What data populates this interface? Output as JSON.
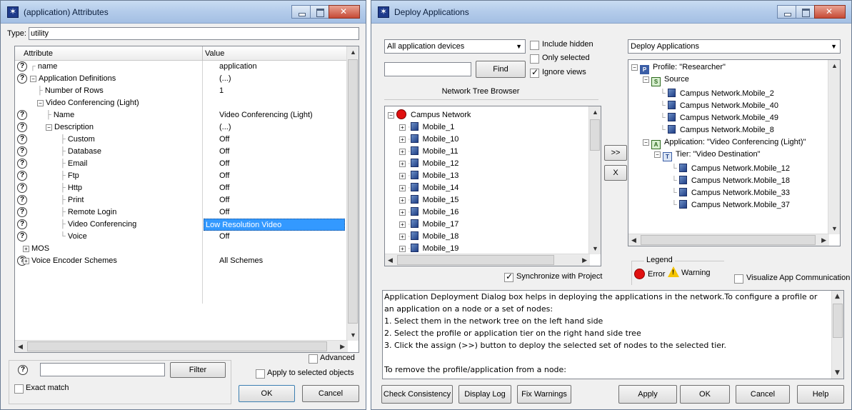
{
  "attributes_window": {
    "title": "(application) Attributes",
    "type_label": "Type:",
    "type_value": "utility",
    "col_attribute": "Attribute",
    "col_value": "Value",
    "rows": [
      {
        "attr": "name",
        "value": "application"
      },
      {
        "attr": "Application Definitions",
        "value": "(...)"
      },
      {
        "attr": "Number of Rows",
        "value": "1"
      },
      {
        "attr": "Video Conferencing (Light)",
        "value": ""
      },
      {
        "attr": "Name",
        "value": "Video Conferencing (Light)"
      },
      {
        "attr": "Description",
        "value": "(...)"
      },
      {
        "attr": "Custom",
        "value": "Off"
      },
      {
        "attr": "Database",
        "value": "Off"
      },
      {
        "attr": "Email",
        "value": "Off"
      },
      {
        "attr": "Ftp",
        "value": "Off"
      },
      {
        "attr": "Http",
        "value": "Off"
      },
      {
        "attr": "Print",
        "value": "Off"
      },
      {
        "attr": "Remote Login",
        "value": "Off"
      },
      {
        "attr": "Video Conferencing",
        "value": "Low Resolution Video"
      },
      {
        "attr": "Voice",
        "value": "Off"
      },
      {
        "attr": "MOS",
        "value": ""
      },
      {
        "attr": "Voice Encoder Schemes",
        "value": "All Schemes"
      }
    ],
    "advanced_label": "Advanced",
    "filter_button": "Filter",
    "apply_selected_label": "Apply to selected objects",
    "exact_match_label": "Exact match",
    "ok_button": "OK",
    "cancel_button": "Cancel",
    "filter_value": ""
  },
  "deploy_window": {
    "title": "Deploy Applications",
    "device_filter": "All application devices",
    "include_hidden": "Include hidden",
    "only_selected": "Only selected",
    "ignore_views": "Ignore views",
    "find_button": "Find",
    "find_value": "",
    "tree_browser_label": "Network Tree Browser",
    "tree_root": "Campus Network",
    "tree_nodes": [
      "Mobile_1",
      "Mobile_10",
      "Mobile_11",
      "Mobile_12",
      "Mobile_13",
      "Mobile_14",
      "Mobile_15",
      "Mobile_16",
      "Mobile_17",
      "Mobile_18",
      "Mobile_19"
    ],
    "assign_button": ">>",
    "remove_button": "X",
    "sync_label": "Synchronize with Project",
    "right_dropdown": "Deploy Applications",
    "profile_label": "Profile: \"Researcher\"",
    "source_label": "Source",
    "source_nodes": [
      "Campus Network.Mobile_2",
      "Campus Network.Mobile_40",
      "Campus Network.Mobile_49",
      "Campus Network.Mobile_8"
    ],
    "application_label": "Application: \"Video Conferencing (Light)\"",
    "tier_label": "Tier: \"Video Destination\"",
    "tier_nodes": [
      "Campus Network.Mobile_12",
      "Campus Network.Mobile_18",
      "Campus Network.Mobile_33",
      "Campus Network.Mobile_37"
    ],
    "legend_title": "Legend",
    "legend_error": "Error",
    "legend_warning": "Warning",
    "visualize_label": "Visualize App Communication",
    "help_lines": [
      "Application Deployment Dialog box helps in deploying the applications in the network.To configure a profile or",
      "an application on a node or a set of nodes:",
      "1. Select them in the network tree on the left hand side",
      "2. Select the profile or application tier on the right hand side tree",
      "3. Click the assign (>>) button to deploy the selected set of nodes to the selected tier.",
      "",
      "To remove the profile/application from a node:"
    ],
    "buttons": {
      "check": "Check Consistency",
      "log": "Display Log",
      "fix": "Fix Warnings",
      "apply": "Apply",
      "ok": "OK",
      "cancel": "Cancel",
      "help": "Help"
    }
  },
  "colors": {
    "selection": "#3399ff",
    "error_red": "#e01010",
    "warning_yellow": "#f5c400"
  }
}
